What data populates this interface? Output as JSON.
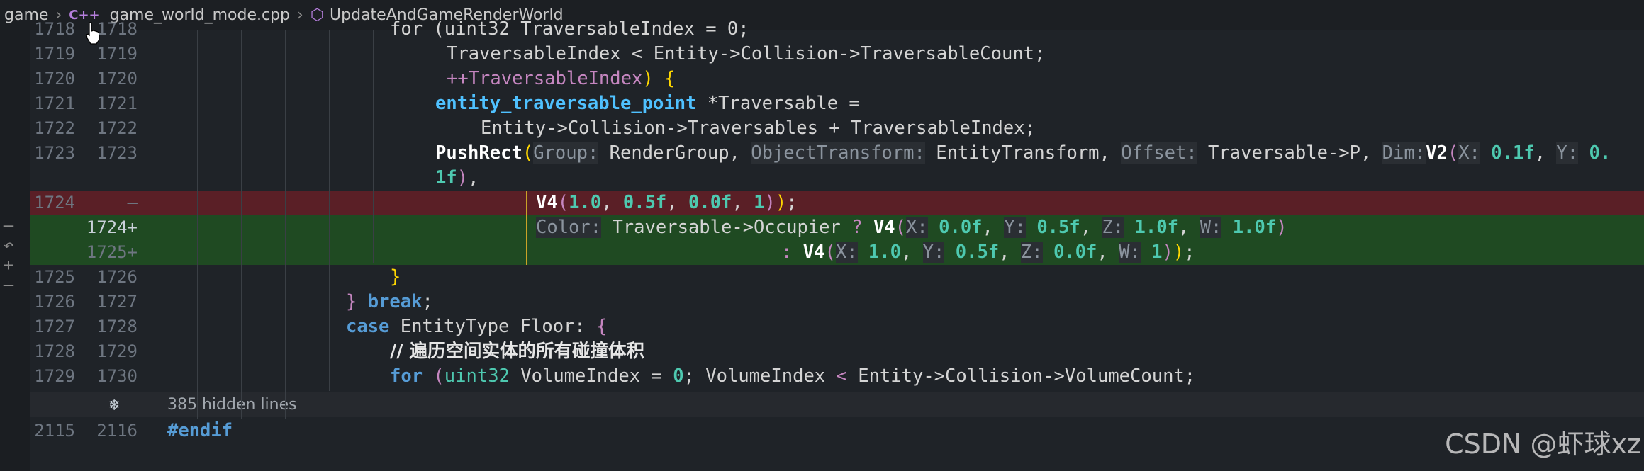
{
  "breadcrumb": {
    "items": [
      "game",
      "game_world_mode.cpp",
      "UpdateAndGameRenderWorld"
    ],
    "file_icon": "C++",
    "symbol_icon": "cube-icon"
  },
  "lines": {
    "l0": {
      "old": "1718",
      "new": "1718"
    },
    "l1": {
      "old": "1719",
      "new": "1719"
    },
    "l2": {
      "old": "1720",
      "new": "1720"
    },
    "l3": {
      "old": "1721",
      "new": "1721"
    },
    "l4": {
      "old": "1722",
      "new": "1722"
    },
    "l5": {
      "old": "1723",
      "new": "1723"
    },
    "l7": {
      "old": "1724",
      "new": "—"
    },
    "l8": {
      "old": "",
      "new": "1724+"
    },
    "l9": {
      "old": "",
      "new": "1725+"
    },
    "l10": {
      "old": "1725",
      "new": "1726"
    },
    "l11": {
      "old": "1726",
      "new": "1727"
    },
    "l12": {
      "old": "1727",
      "new": "1728"
    },
    "l13": {
      "old": "1728",
      "new": "1729"
    },
    "l14": {
      "old": "1729",
      "new": "1730"
    },
    "l16": {
      "old": "2115",
      "new": "2116"
    }
  },
  "hidden": {
    "label": "385 hidden lines"
  },
  "code": {
    "t0": "for (uint32 TraversableIndex = 0;",
    "t1": "TraversableIndex < Entity->Collision->TraversableCount;",
    "t2a": "++TraversableIndex",
    "t2b": ") {",
    "t3a": "entity_traversable_point",
    "t3b": " *Traversable =",
    "t4": "Entity->Collision->Traversables + TraversableIndex;",
    "comment": "// 遍历空间实体的所有碰撞体积",
    "endif": "#endif"
  },
  "watermark": "CSDN @虾球xz"
}
